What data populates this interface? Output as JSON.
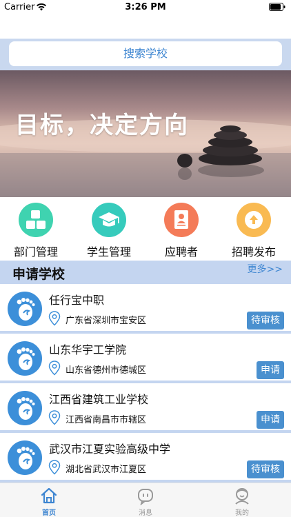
{
  "status_bar": {
    "carrier": "Carrier",
    "time": "3:26 PM"
  },
  "search": {
    "label": "搜索学校"
  },
  "banner": {
    "slogan": "目标，决定方向"
  },
  "quick_menu": [
    {
      "label": "部门管理",
      "icon": "blocks-icon",
      "color": "#3fd3b0"
    },
    {
      "label": "学生管理",
      "icon": "graduation-cap-icon",
      "color": "#36cbbc"
    },
    {
      "label": "应聘者",
      "icon": "id-card-icon",
      "color": "#f47b58"
    },
    {
      "label": "招聘发布",
      "icon": "upload-icon",
      "color": "#f9ba52"
    }
  ],
  "section": {
    "title": "申请学校",
    "more": "更多>>"
  },
  "schools": [
    {
      "name": "任行宝中职",
      "location": "广东省深圳市宝安区",
      "action": "待审核"
    },
    {
      "name": "山东华宇工学院",
      "location": "山东省德州市德城区",
      "action": "申请"
    },
    {
      "name": "江西省建筑工业学校",
      "location": "江西省南昌市市辖区",
      "action": "申请"
    },
    {
      "name": "武汉市江夏实验高级中学",
      "location": "湖北省武汉市江夏区",
      "action": "待审核"
    }
  ],
  "tabs": [
    {
      "label": "首页",
      "icon": "home-icon",
      "active": true
    },
    {
      "label": "消息",
      "icon": "message-icon",
      "active": false
    },
    {
      "label": "我的",
      "icon": "profile-icon",
      "active": false
    }
  ],
  "colors": {
    "accent": "#3e86d1",
    "section_bg": "#c4d5f0",
    "button": "#4a90cf",
    "tab_active": "#3e86d1",
    "tab_inactive": "#999999"
  }
}
